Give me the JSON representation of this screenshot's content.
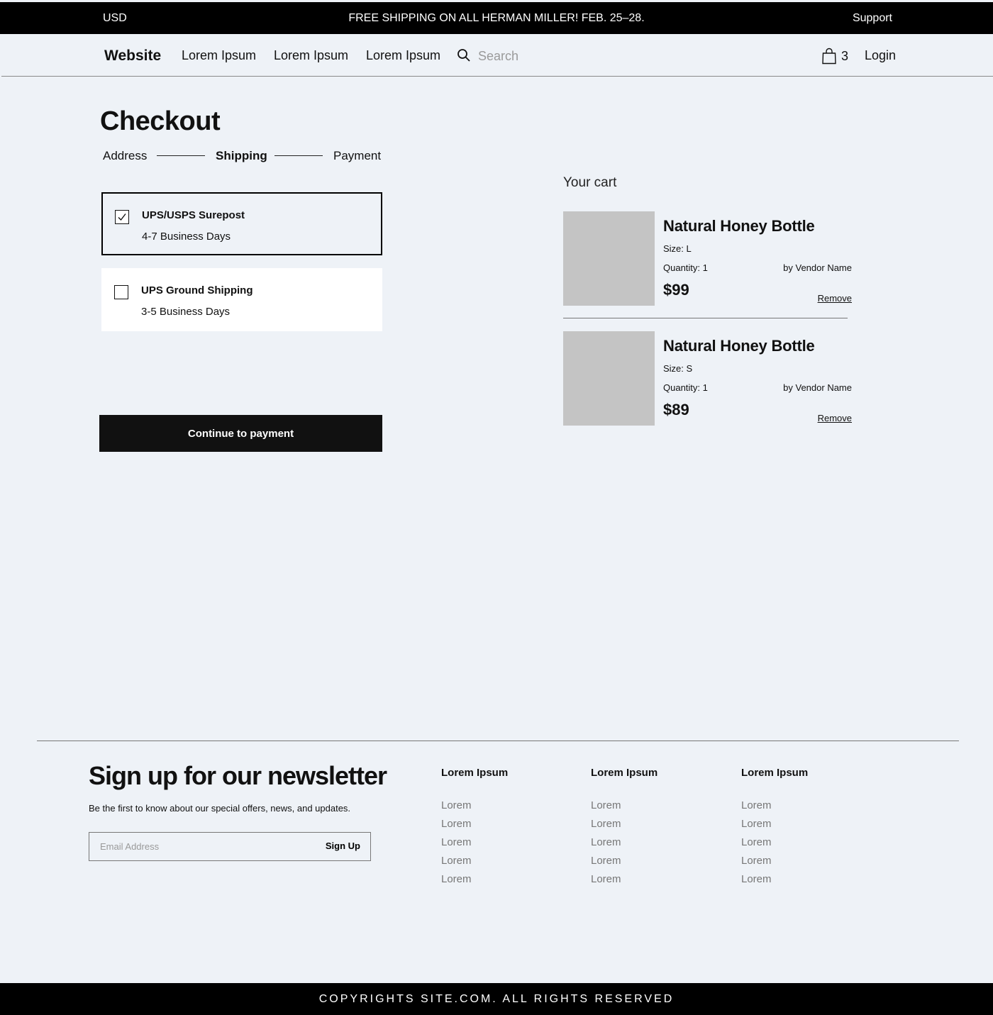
{
  "topbar": {
    "currency": "USD",
    "promo": "FREE SHIPPING ON ALL HERMAN MILLER! FEB. 25–28.",
    "support": "Support"
  },
  "nav": {
    "brand": "Website",
    "links": [
      "Lorem Ipsum",
      "Lorem Ipsum",
      "Lorem Ipsum"
    ],
    "search_placeholder": "Search",
    "cart_count": "3",
    "login": "Login"
  },
  "checkout": {
    "title": "Checkout",
    "steps": [
      "Address",
      "Shipping",
      "Payment"
    ],
    "active_step": "Shipping",
    "options": [
      {
        "name": "UPS/USPS Surepost",
        "days": "4-7 Business Days",
        "selected": true
      },
      {
        "name": "UPS Ground Shipping",
        "days": "3-5 Business Days",
        "selected": false
      }
    ],
    "continue_label": "Continue to payment"
  },
  "cart": {
    "title": "Your cart",
    "items": [
      {
        "name": "Natural Honey Bottle",
        "size": "Size: L",
        "quantity": "Quantity: 1",
        "vendor": "by Vendor Name",
        "price": "$99",
        "remove": "Remove"
      },
      {
        "name": "Natural Honey Bottle",
        "size": "Size: S",
        "quantity": "Quantity: 1",
        "vendor": "by Vendor Name",
        "price": "$89",
        "remove": "Remove"
      }
    ]
  },
  "footer": {
    "newsletter_title": "Sign up for our newsletter",
    "newsletter_sub": "Be the first to know about our special offers, news, and updates.",
    "email_placeholder": "Email Address",
    "signup_label": "Sign Up",
    "columns": [
      {
        "heading": "Lorem Ipsum",
        "links": [
          "Lorem",
          "Lorem",
          "Lorem",
          "Lorem",
          "Lorem"
        ]
      },
      {
        "heading": "Lorem Ipsum",
        "links": [
          "Lorem",
          "Lorem",
          "Lorem",
          "Lorem",
          "Lorem"
        ]
      },
      {
        "heading": "Lorem Ipsum",
        "links": [
          "Lorem",
          "Lorem",
          "Lorem",
          "Lorem",
          "Lorem"
        ]
      }
    ],
    "copyright": "COPYRIGHTS SITE.COM. ALL RIGHTS RESERVED"
  }
}
